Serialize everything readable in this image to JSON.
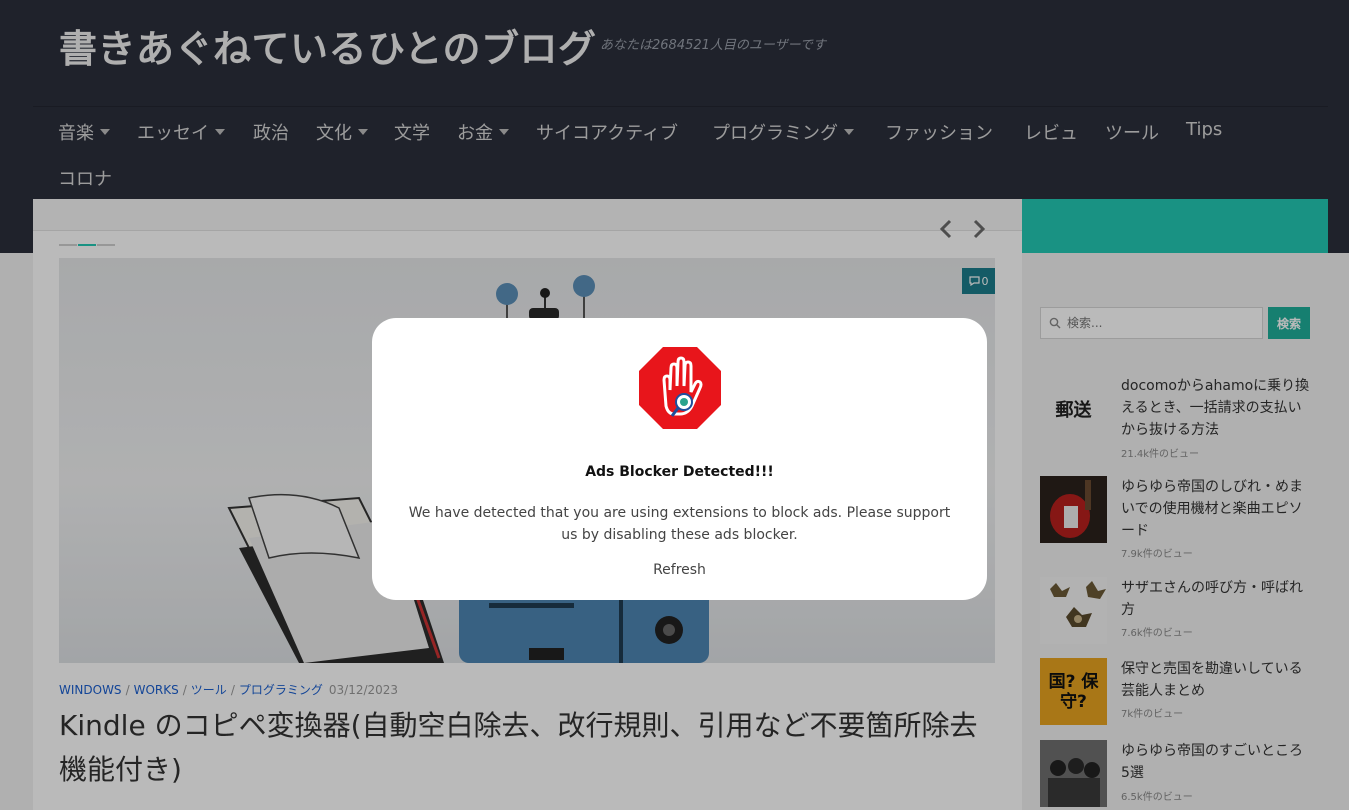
{
  "header": {
    "site_title": "書きあぐねているひとのブログ",
    "site_desc": "あなたは2684521人目のユーザーです"
  },
  "nav": {
    "items": [
      {
        "label": "音楽",
        "caret": true
      },
      {
        "label": "エッセイ",
        "caret": true
      },
      {
        "label": "政治",
        "caret": false
      },
      {
        "label": "文化",
        "caret": true
      },
      {
        "label": "文学",
        "caret": false
      },
      {
        "label": "お金",
        "caret": true
      },
      {
        "label": "サイコアクティブ",
        "caret": false
      },
      {
        "label": "プログラミング",
        "caret": true
      },
      {
        "label": "ファッション",
        "caret": false
      },
      {
        "label": "レビュ",
        "caret": false
      },
      {
        "label": "ツール",
        "caret": false
      },
      {
        "label": "Tips",
        "caret": false
      },
      {
        "label": "コロナ",
        "caret": false
      }
    ]
  },
  "slider": {
    "prev_icon": "chevron-left-icon",
    "next_icon": "chevron-right-icon"
  },
  "post": {
    "comment_count": "0",
    "categories": [
      "WINDOWS",
      "WORKS",
      "ツール",
      "プログラミング"
    ],
    "date": "03/12/2023",
    "title": "Kindle のコピペ変換器(自動空白除去、改行規則、引用など不要箇所除去機能付き)"
  },
  "sidebar": {
    "search_placeholder": "検索...",
    "search_button": "検索",
    "popular": [
      {
        "title": "docomoからahamoに乗り換えるとき、一括請求の支払いから抜ける方法",
        "views": "21.4k件のビュー",
        "thumb_text": "郵送"
      },
      {
        "title": "ゆらゆら帝国のしびれ・めまいでの使用機材と楽曲エピソード",
        "views": "7.9k件のビュー",
        "thumb_text": ""
      },
      {
        "title": "サザエさんの呼び方・呼ばれ方",
        "views": "7.6k件のビュー",
        "thumb_text": ""
      },
      {
        "title": "保守と売国を勘違いしている芸能人まとめ",
        "views": "7k件のビュー",
        "thumb_text": "国? 保守?"
      },
      {
        "title": "ゆらゆら帝国のすごいところ5選",
        "views": "6.5k件のビュー",
        "thumb_text": ""
      }
    ]
  },
  "modal": {
    "icon": "stop-hand-icon",
    "title": "Ads Blocker Detected!!!",
    "text": "We have detected that you are using extensions to block ads. Please support us by disabling these ads blocker.",
    "refresh": "Refresh",
    "accent_color": "#e8151b"
  },
  "colors": {
    "header_bg": "#2b2f3c",
    "accent_teal": "#23c9b4",
    "link_blue": "#1b5fd0"
  }
}
